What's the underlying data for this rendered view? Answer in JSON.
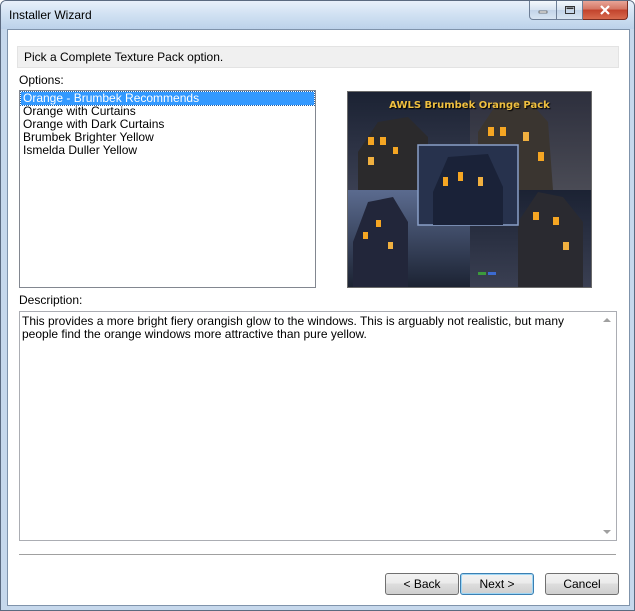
{
  "window": {
    "title": "Installer Wizard"
  },
  "caption_buttons": {
    "minimize_icon": "minimize-icon",
    "maximize_icon": "maximize-icon",
    "close_icon": "close-icon"
  },
  "header": {
    "text": "Pick a Complete Texture Pack option."
  },
  "options": {
    "label": "Options:",
    "items": [
      {
        "label": "Orange - Brumbek Recommends",
        "selected": true
      },
      {
        "label": "Orange with Curtains",
        "selected": false
      },
      {
        "label": "Orange with Dark Curtains",
        "selected": false
      },
      {
        "label": "Brumbek Brighter Yellow",
        "selected": false
      },
      {
        "label": "Ismelda Duller Yellow",
        "selected": false
      }
    ]
  },
  "preview": {
    "caption": "AWLS Brumbek Orange Pack"
  },
  "description": {
    "label": "Description:",
    "text": "This provides a more bright fiery orangish glow to the windows. This is arguably not realistic, but many people find the orange windows more attractive than pure yellow."
  },
  "buttons": {
    "back": "< Back",
    "next": "Next >",
    "cancel": "Cancel"
  },
  "colors": {
    "selection": "#3399ff",
    "accent_title": "#f0c040",
    "window_glow": "#f5a623"
  }
}
